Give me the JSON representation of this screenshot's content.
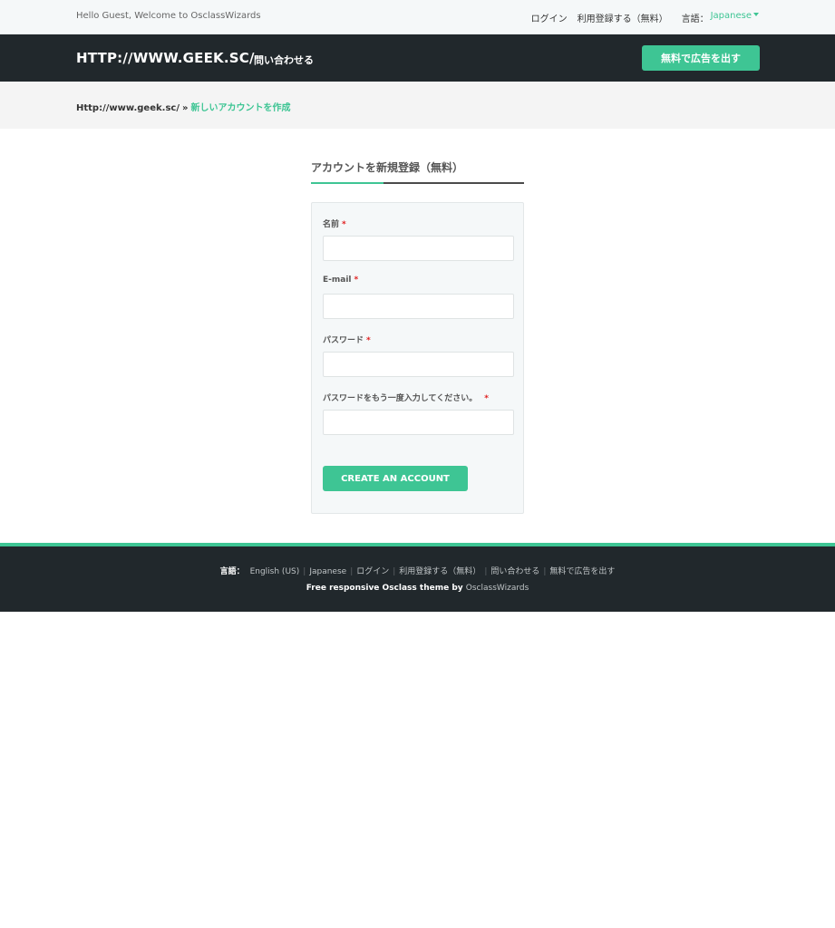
{
  "topbar": {
    "welcome": "Hello Guest, Welcome to OsclassWizards",
    "login": "ログイン",
    "register": "利用登録する（無料）",
    "language_label": "言語：",
    "language_value": "Japanese"
  },
  "header": {
    "logo": "HTTP://WWW.GEEK.SC/",
    "contact": "問い合わせる",
    "post_button": "無料で広告を出す"
  },
  "breadcrumb": {
    "home": "Http://www.geek.sc/",
    "separator": "»",
    "current": "新しいアカウントを作成"
  },
  "form": {
    "title": "アカウントを新規登録（無料）",
    "required_mark": "*",
    "fields": [
      {
        "label": "名前",
        "value": ""
      },
      {
        "label": "E-mail",
        "value": ""
      },
      {
        "label": "パスワード",
        "value": ""
      },
      {
        "label": "パスワードをもう一度入力してください。",
        "value": ""
      }
    ],
    "submit": "CREATE AN ACCOUNT"
  },
  "footer": {
    "language_label": "言語：",
    "links": [
      "English (US)",
      "Japanese",
      "ログイン",
      "利用登録する（無料）",
      "問い合わせる",
      "無料で広告を出す"
    ],
    "credit_prefix": "Free responsive Osclass theme by",
    "credit_brand": "OsclassWizards"
  },
  "colors": {
    "accent": "#3ec594",
    "dark": "#21282c",
    "required": "#e02020"
  }
}
